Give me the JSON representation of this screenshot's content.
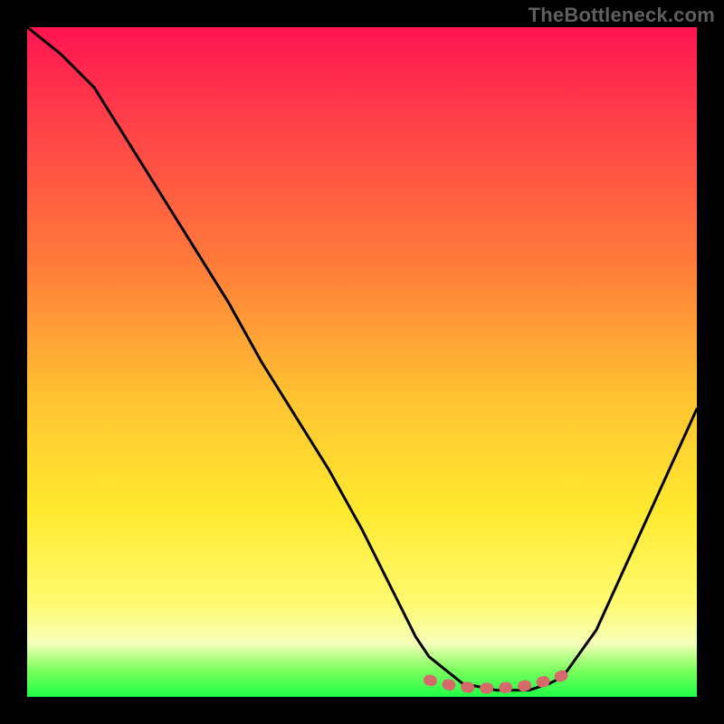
{
  "watermark": "TheBottleneck.com",
  "chart_data": {
    "type": "line",
    "title": "",
    "xlabel": "",
    "ylabel": "",
    "xlim": [
      0,
      100
    ],
    "ylim": [
      0,
      100
    ],
    "grid": false,
    "series": [
      {
        "name": "bottleneck-curve",
        "x": [
          0,
          5,
          10,
          15,
          20,
          25,
          30,
          35,
          40,
          45,
          50,
          55,
          58,
          60,
          65,
          70,
          72,
          75,
          78,
          80,
          85,
          90,
          95,
          100
        ],
        "values": [
          100,
          96,
          91,
          83,
          75,
          67,
          59,
          50,
          42,
          34,
          25,
          15,
          9,
          6,
          2,
          1,
          1,
          1,
          2,
          3,
          10,
          21,
          32,
          43
        ]
      },
      {
        "name": "optimal-marker-band",
        "x": [
          60,
          62,
          64,
          66,
          68,
          70,
          72,
          74,
          76,
          78,
          80
        ],
        "values": [
          2.5,
          2.0,
          1.6,
          1.4,
          1.3,
          1.3,
          1.4,
          1.6,
          2.0,
          2.5,
          3.2
        ]
      }
    ],
    "annotations": [],
    "legend": {
      "visible": false
    }
  },
  "colors": {
    "background_frame": "#000000",
    "curve_stroke": "#000000",
    "marker_band_stroke": "#d66a6a",
    "watermark_text": "#5f5f5f",
    "gradient_stops": [
      "#ff1450",
      "#ff3a4a",
      "#ff7a3a",
      "#ffc232",
      "#ffe92e",
      "#fffb70",
      "#f6ffb8",
      "#7bff5e",
      "#1fff47"
    ]
  }
}
